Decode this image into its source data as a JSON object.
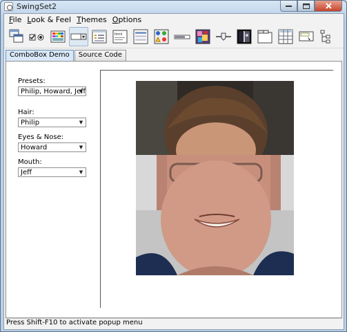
{
  "window": {
    "title": "SwingSet2"
  },
  "menubar": {
    "items": [
      {
        "label": "File",
        "mnemonic": "F",
        "rest": "ile"
      },
      {
        "label": "Look & Feel",
        "mnemonic": "L",
        "rest": "ook & Feel"
      },
      {
        "label": "Themes",
        "mnemonic": "T",
        "rest": "hemes"
      },
      {
        "label": "Options",
        "mnemonic": "O",
        "rest": "ptions"
      }
    ]
  },
  "toolbar": {
    "buttons": [
      "internal-frame-demo-icon",
      "button-demo-icon",
      "color-chooser-demo-icon",
      "combobox-demo-icon",
      "file-chooser-demo-icon",
      "html-demo-icon",
      "list-demo-icon",
      "option-pane-demo-icon",
      "progress-bar-demo-icon",
      "scroll-pane-demo-icon",
      "slider-demo-icon",
      "split-pane-demo-icon",
      "tabbed-pane-demo-icon",
      "table-demo-icon",
      "tooltip-demo-icon",
      "tree-demo-icon"
    ],
    "selected": 3
  },
  "tabs": [
    {
      "label": "ComboBox Demo",
      "active": true
    },
    {
      "label": "Source Code",
      "active": false
    }
  ],
  "controls": {
    "presets": {
      "label": "Presets:",
      "value": "Philip, Howard, Jeff"
    },
    "hair": {
      "label": "Hair:",
      "value": "Philip"
    },
    "eyes_nose": {
      "label": "Eyes & Nose:",
      "value": "Howard"
    },
    "mouth": {
      "label": "Mouth:",
      "value": "Jeff"
    }
  },
  "statusbar": {
    "text": "Press Shift-F10 to activate popup menu"
  }
}
